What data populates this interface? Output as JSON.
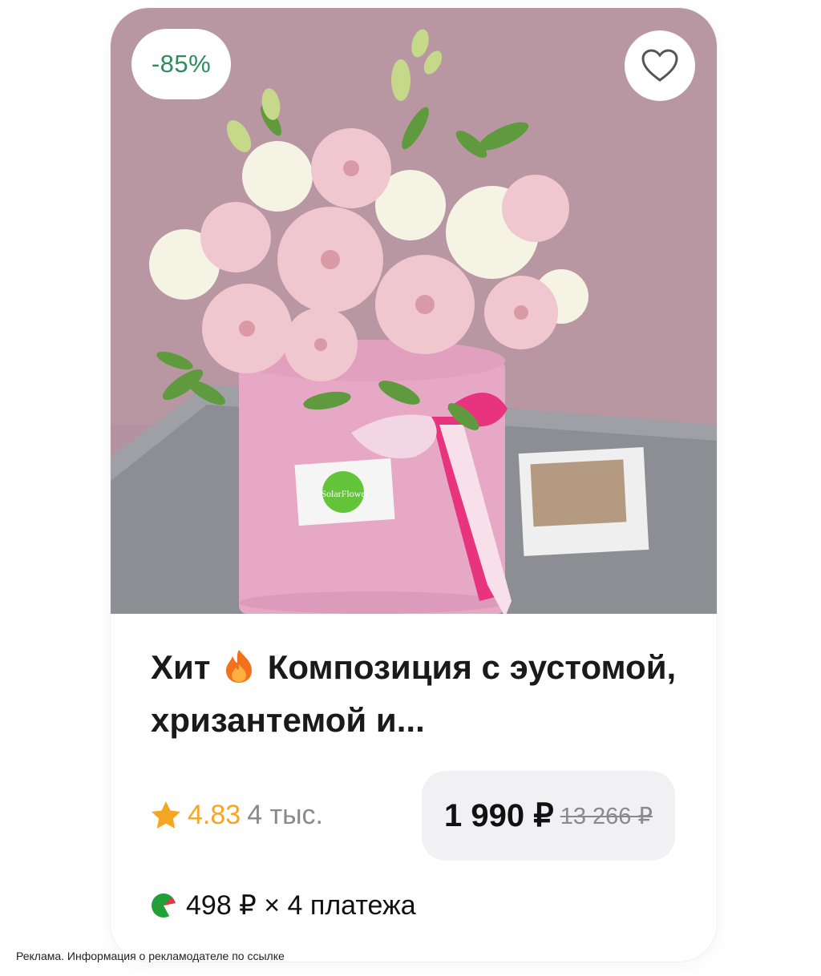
{
  "card": {
    "discount_badge": "-85%",
    "title_prefix": "Хит",
    "title_text": "Композиция с эустомой, хризантемой и...",
    "rating_value": "4.83",
    "reviews_count": "4 тыс.",
    "price": "1 990 ₽",
    "old_price": "13 266 ₽",
    "installment": "498 ₽ × 4 платежа",
    "box_label": "SolarFlower"
  },
  "footer": {
    "ad_notice": "Реклама. Информация о рекламодателе по ссылке"
  },
  "icons": {
    "favorite": "heart-outline-icon",
    "hit": "fire-icon",
    "rating": "star-icon",
    "installment": "split-payment-icon"
  },
  "colors": {
    "discount": "#2d8c5e",
    "star": "#f5a623",
    "installment_green": "#21a038"
  }
}
